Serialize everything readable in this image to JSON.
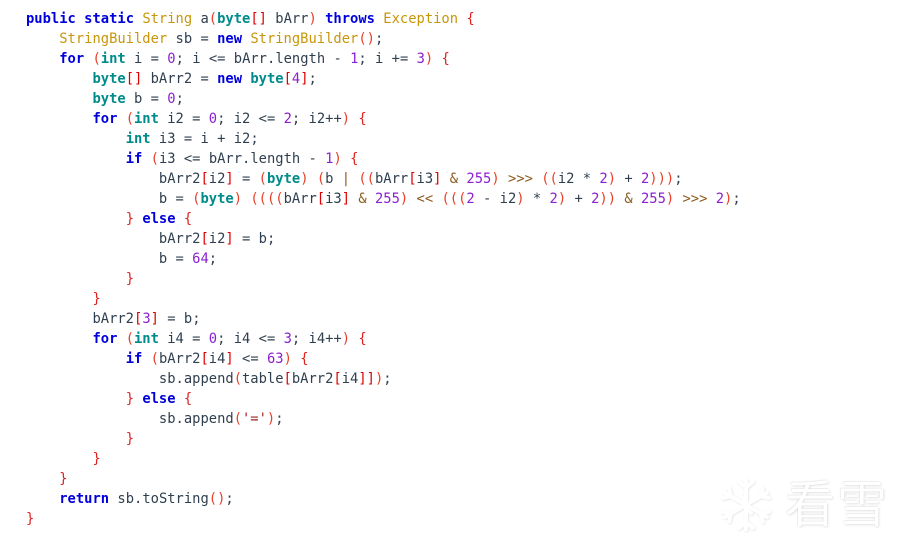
{
  "editor": {
    "language": "java",
    "background_color": "#ffffff",
    "default_text_color": "#2f3f4f",
    "syntax_colors": {
      "keyword": "#0000dd",
      "primitive_type": "#008b8b",
      "class_name": "#c8960a",
      "identifier": "#2f3f4f",
      "number": "#8b21d0",
      "string": "#a02020",
      "paren": "#e8402a",
      "bracket": "#dd0000",
      "brace": "#dd2222",
      "bitwise_operator": "#8a5a1e"
    },
    "lines": [
      "public static String a(byte[] bArr) throws Exception {",
      "    StringBuilder sb = new StringBuilder();",
      "    for (int i = 0; i <= bArr.length - 1; i += 3) {",
      "        byte[] bArr2 = new byte[4];",
      "        byte b = 0;",
      "        for (int i2 = 0; i2 <= 2; i2++) {",
      "            int i3 = i + i2;",
      "            if (i3 <= bArr.length - 1) {",
      "                bArr2[i2] = (byte) (b | ((bArr[i3] & 255) >>> ((i2 * 2) + 2)));",
      "                b = (byte) ((((bArr[i3] & 255) << (((2 - i2) * 2) + 2)) & 255) >>> 2);",
      "            } else {",
      "                bArr2[i2] = b;",
      "                b = 64;",
      "            }",
      "        }",
      "        bArr2[3] = b;",
      "        for (int i4 = 0; i4 <= 3; i4++) {",
      "            if (bArr2[i4] <= 63) {",
      "                sb.append(table[bArr2[i4]]);",
      "            } else {",
      "                sb.append('=');",
      "            }",
      "        }",
      "    }",
      "    return sb.toString();",
      "}"
    ]
  },
  "watermark": {
    "icon": "snowflake-icon",
    "text": "看雪",
    "color": "#ffffff"
  }
}
